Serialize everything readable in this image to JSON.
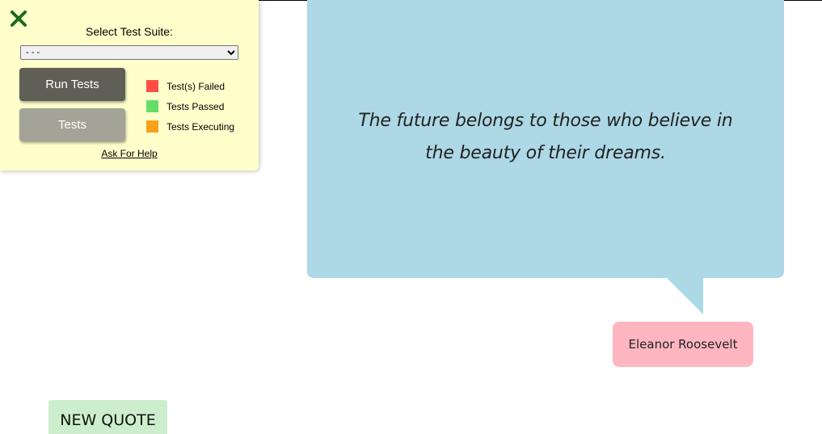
{
  "test_panel": {
    "close_icon": "close-x-icon",
    "close_color": "#1a6b1a",
    "select_label": "Select Test Suite:",
    "select_value": "- - -",
    "run_button": "Run Tests",
    "tests_button": "Tests",
    "legend": [
      {
        "label": "Test(s) Failed",
        "color": "#ff4f45"
      },
      {
        "label": "Tests Passed",
        "color": "#66dd66"
      },
      {
        "label": "Tests Executing",
        "color": "#f9a11b"
      }
    ],
    "help_link": "Ask For Help"
  },
  "quote": {
    "text": "The future belongs to those who believe in the beauty of their dreams.",
    "author": "Eleanor Roosevelt",
    "bubble_color": "#add8e6",
    "author_color": "#ffb6c1"
  },
  "new_quote_button": "NEW QUOTE"
}
